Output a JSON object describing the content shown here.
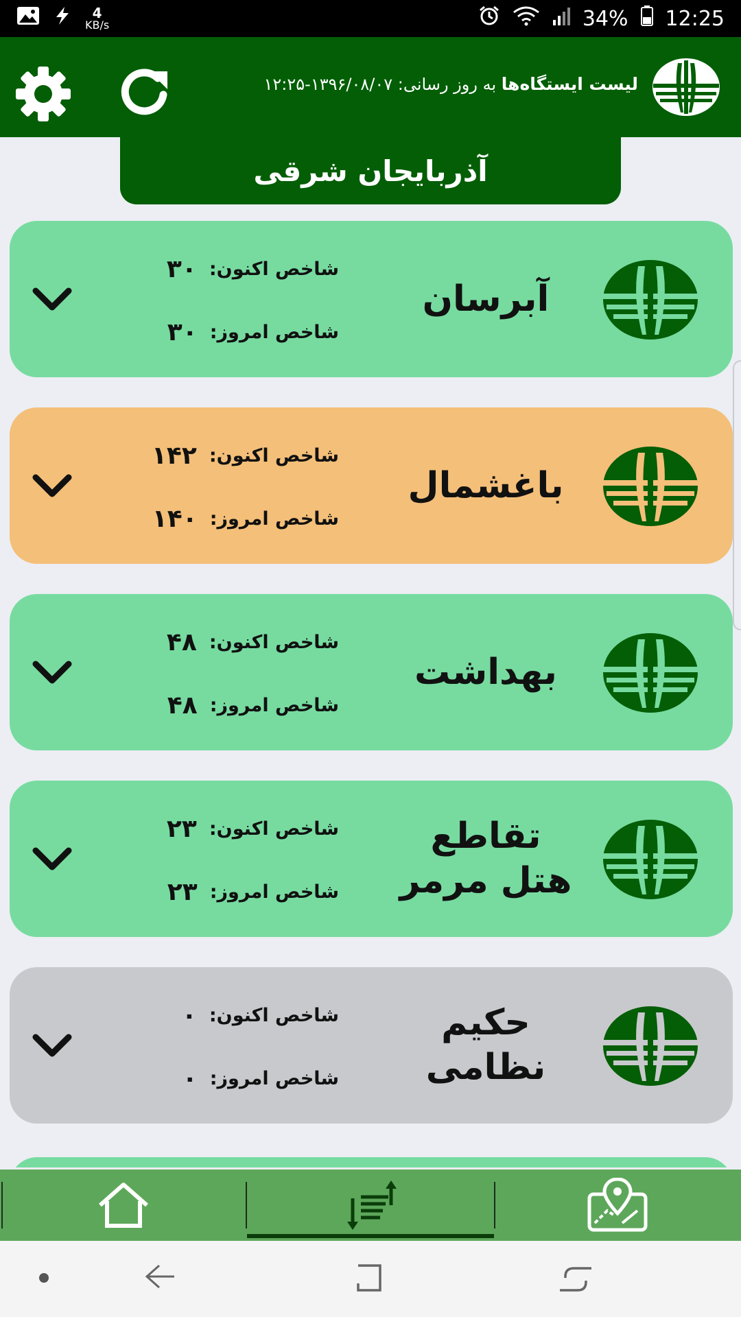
{
  "status_bar": {
    "speed_value": "4",
    "speed_unit": "KB/s",
    "battery": "34%",
    "time": "12:25"
  },
  "header": {
    "title": "لیست ایستگاه‌ها",
    "updated_label": "به روز رسانی:",
    "updated_value": "۱۳۹۶/۰۸/۰۷-۱۲:۲۵",
    "brand_color": "#035e06"
  },
  "province": "آذربایجان شرقی",
  "labels": {
    "now_index": "شاخص اکنون:",
    "today_index": "شاخص امروز:"
  },
  "stations": [
    {
      "name": "آبرسان",
      "now": "۳۰",
      "today": "۳۰",
      "color": "#77dba0"
    },
    {
      "name": "باغشمال",
      "now": "۱۴۲",
      "today": "۱۴۰",
      "color": "#f4bf79"
    },
    {
      "name": "بهداشت",
      "now": "۴۸",
      "today": "۴۸",
      "color": "#77dba0"
    },
    {
      "name": "تقاطع هتل مرمر",
      "now": "۲۳",
      "today": "۲۳",
      "color": "#77dba0"
    },
    {
      "name": "حکیم نظامی",
      "now": "۰",
      "today": "۰",
      "color": "#c8c9cc"
    }
  ],
  "bottom_nav": {
    "items": [
      {
        "icon": "home-icon"
      },
      {
        "icon": "sort-list-icon",
        "active": true
      },
      {
        "icon": "map-pin-icon"
      }
    ]
  }
}
